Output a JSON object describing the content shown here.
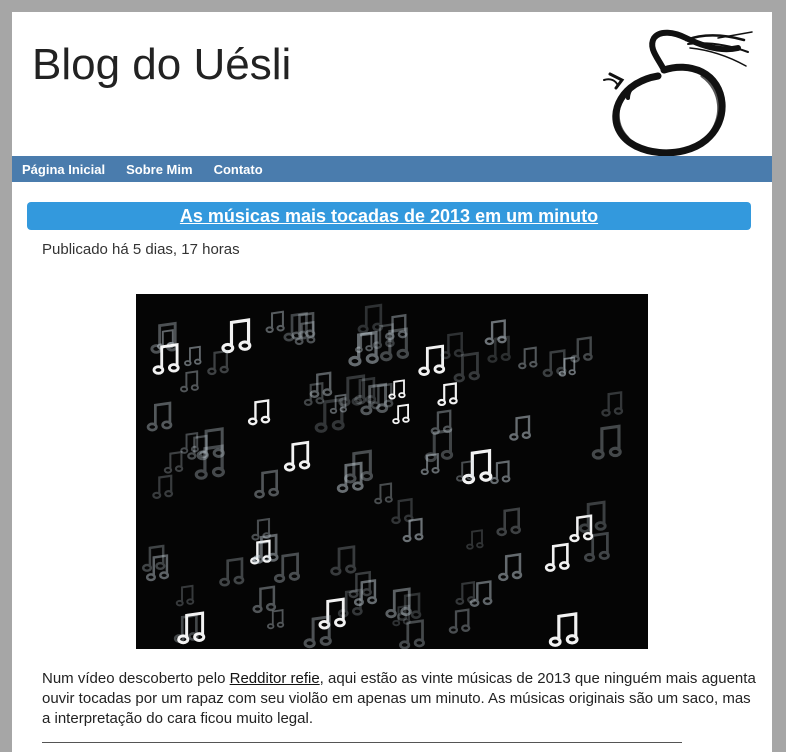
{
  "blog": {
    "title": "Blog do Uésli"
  },
  "nav": {
    "items": [
      {
        "label": "Página Inicial"
      },
      {
        "label": "Sobre Mim"
      },
      {
        "label": "Contato"
      }
    ]
  },
  "post": {
    "title": "As músicas mais tocadas de 2013 em um minuto",
    "meta": "Publicado há 5 dias, 17 horas",
    "image_icon": "music-notes-photo",
    "body": {
      "before_link": "Num vídeo descoberto pelo ",
      "link_text": "Redditor refie",
      "after_link": ", aqui estão as vinte músicas de 2013 que ninguém mais aguenta ouvir tocadas por um rapaz com seu violão em apenas um minuto. As músicas originais são um saco, mas a interpretação do cara ficou muito legal."
    }
  },
  "colors": {
    "nav_bar": "#4a7cad",
    "title_bar": "#3399dd",
    "frame": "#a6a6a6"
  }
}
